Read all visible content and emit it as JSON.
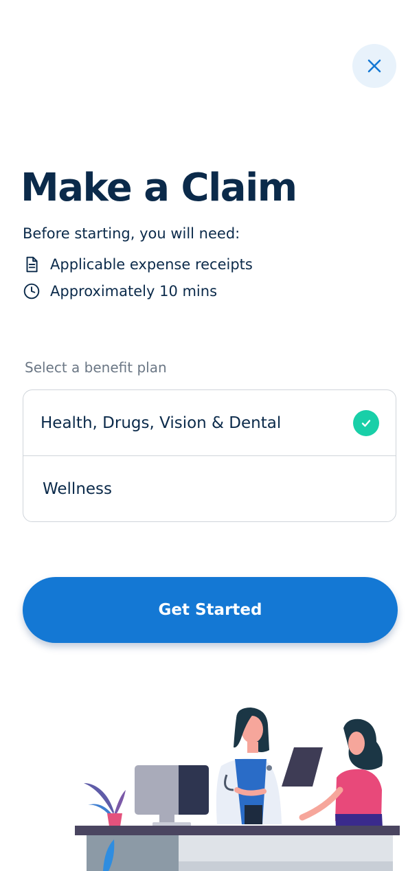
{
  "header": {
    "close_icon": "close-icon",
    "title": "Make a Claim"
  },
  "requirements": {
    "intro": "Before starting, you will need:",
    "items": [
      {
        "icon": "document-icon",
        "text": "Applicable expense receipts"
      },
      {
        "icon": "clock-icon",
        "text": "Approximately 10 mins"
      }
    ]
  },
  "benefit_plan": {
    "label": "Select a benefit plan",
    "options": [
      {
        "label": "Health, Drugs, Vision & Dental",
        "selected": true
      },
      {
        "label": "Wellness",
        "selected": false
      }
    ]
  },
  "cta": {
    "label": "Get Started"
  },
  "colors": {
    "primary": "#1478d4",
    "title": "#0b2a4a",
    "check": "#19cfa8",
    "close_bg": "#e8f2fb"
  }
}
